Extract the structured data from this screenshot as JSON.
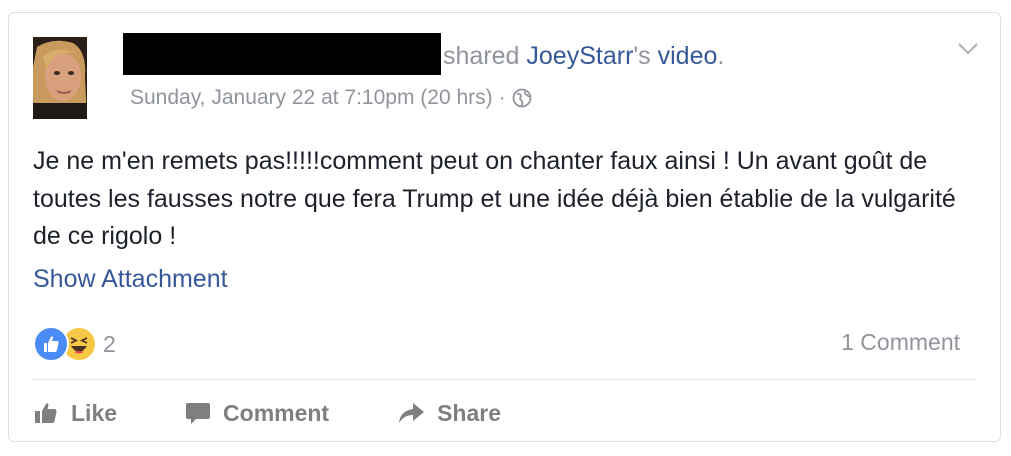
{
  "header": {
    "shared_word": "shared",
    "page_name": "JoeyStarr",
    "possessive": "'s",
    "object": "video",
    "period": ".",
    "timestamp": "Sunday, January 22 at 7:10pm (20 hrs)",
    "separator": "·",
    "audience_icon": "globe-icon",
    "menu_icon": "chevron-down-icon"
  },
  "post": {
    "text": "Je ne m'en remets pas!!!!!comment peut on chanter faux ainsi ! Un avant goût de toutes les fausses notre que fera Trump et une idée déjà bien établie de la vulgarité de ce rigolo !",
    "show_attachment": "Show Attachment"
  },
  "reactions": {
    "icons": [
      "like-icon",
      "haha-icon"
    ],
    "count": "2",
    "comments_label": "1 Comment"
  },
  "actions": {
    "like": "Like",
    "comment": "Comment",
    "share": "Share"
  },
  "colors": {
    "link": "#365899",
    "meta_grey": "#90949c",
    "text": "#1d2129",
    "like_blue": "#4b8bf5",
    "haha_yellow": "#f7c846"
  }
}
